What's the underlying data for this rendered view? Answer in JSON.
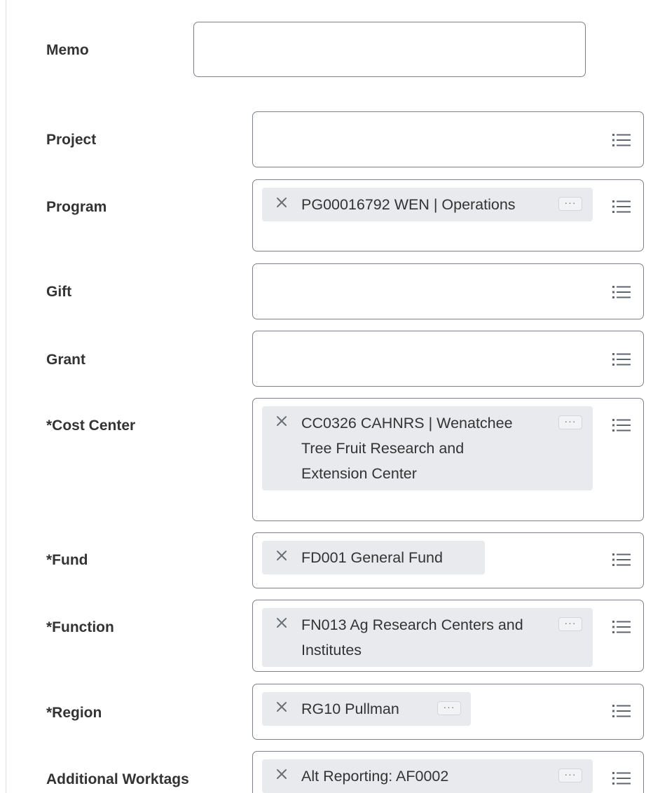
{
  "form": {
    "memo": {
      "label": "Memo",
      "value": ""
    },
    "project": {
      "label": "Project",
      "value": ""
    },
    "program": {
      "label": "Program",
      "value": "PG00016792 WEN | Operations"
    },
    "gift": {
      "label": "Gift",
      "value": ""
    },
    "grant": {
      "label": "Grant",
      "value": ""
    },
    "cost_center": {
      "label": "*Cost Center",
      "value": "CC0326 CAHNRS | Wenatchee Tree Fruit Research and Extension Center"
    },
    "fund": {
      "label": "*Fund",
      "value": "FD001 General Fund"
    },
    "function": {
      "label": "*Function",
      "value": "FN013 Ag Research Centers and Institutes"
    },
    "region": {
      "label": "*Region",
      "value": "RG10 Pullman"
    },
    "additional_worktags": {
      "label": "Additional Worktags",
      "value": "Alt Reporting: AF0002"
    }
  },
  "icons": {
    "prompt": "prompt-list-icon",
    "remove": "close-icon",
    "more": "more-options-icon"
  },
  "glyphs": {
    "more": "···"
  },
  "colors": {
    "label": "#333333",
    "field_border": "#7b8089",
    "pill_background": "#e8eaed",
    "icon": "#5f6670"
  }
}
